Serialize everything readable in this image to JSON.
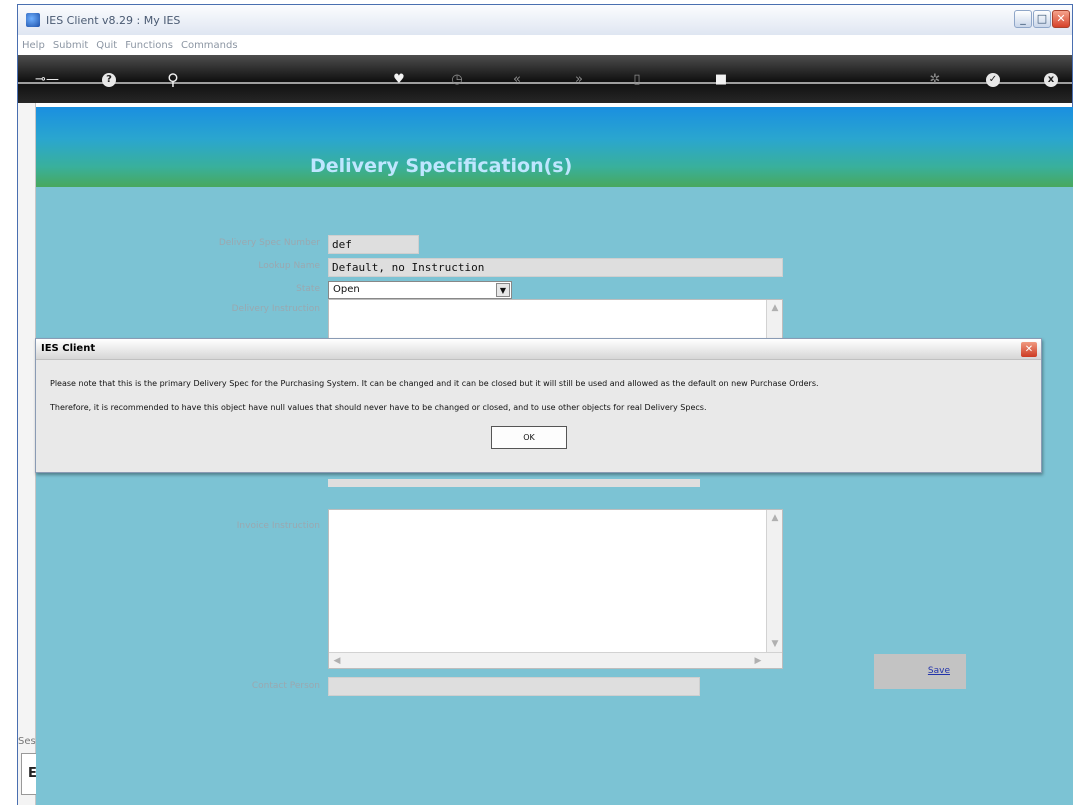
{
  "window": {
    "title": "IES Client v8.29 : My IES"
  },
  "menu": [
    "Help",
    "Submit",
    "Quit",
    "Functions",
    "Commands"
  ],
  "page": {
    "title": "Delivery Specification(s)"
  },
  "form": {
    "spec_number_label": "Delivery Spec Number",
    "spec_number_value": "def",
    "lookup_label": "Lookup Name",
    "lookup_value": "Default, no Instruction",
    "state_label": "State",
    "state_value": "Open",
    "delivery_label": "Delivery Instruction",
    "invoice_label": "Invoice Instruction",
    "contact_label": "Contact Person",
    "save_label": "Save"
  },
  "dialog": {
    "title": "IES Client",
    "message_1": "Please note that this is the primary Delivery Spec for the Purchasing System. It can be changed and it can be closed but it will still be used and allowed as the default on new Purchase Orders.",
    "message_2": "Therefore, it is recommended to have this object have null values that should never have to be changed or closed, and to use other objects for real Delivery Specs.",
    "ok_label": "OK"
  },
  "side": {
    "label": "Ses",
    "box_label": "E"
  },
  "icons": [
    "key-icon",
    "help-icon",
    "search-icon",
    "heart-icon",
    "clock-icon",
    "rewind-icon",
    "forward-icon",
    "document-icon",
    "stop-icon",
    "settings-icon",
    "check-icon",
    "close-icon"
  ]
}
